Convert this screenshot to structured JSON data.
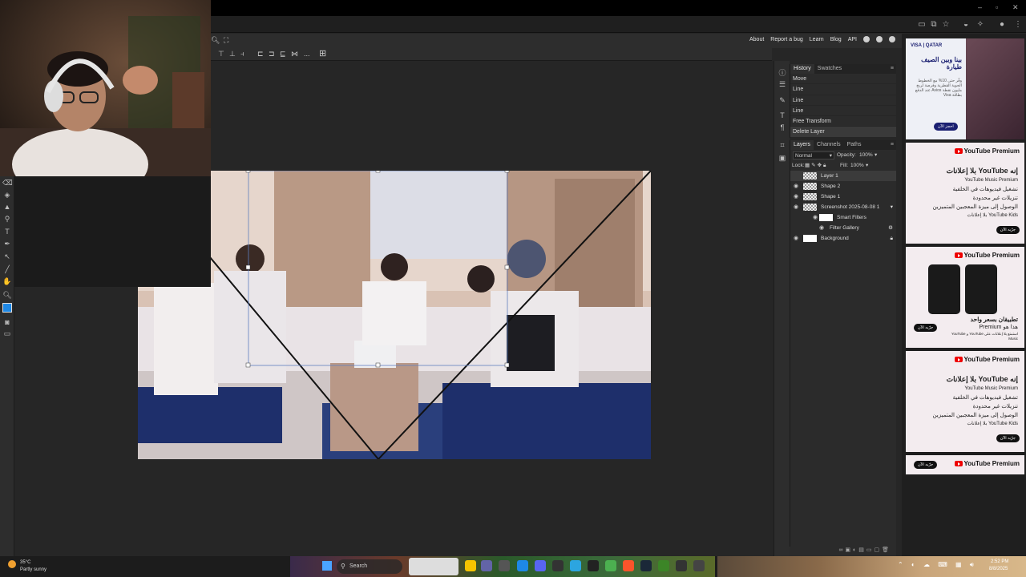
{
  "menu": {
    "links": [
      "About",
      "Report a bug",
      "Learn",
      "Blog",
      "API"
    ]
  },
  "options_bar": {
    "extra_label": "..."
  },
  "history_panel": {
    "tabs": [
      "History",
      "Swatches"
    ],
    "items": [
      "Move",
      "Line",
      "Line",
      "Line",
      "Free Transform",
      "Delete Layer"
    ]
  },
  "layers_panel": {
    "tabs": [
      "Layers",
      "Channels",
      "Paths"
    ],
    "blend_mode": "Normal",
    "opacity_label": "Opacity:",
    "opacity_value": "100%",
    "lock_label": "Lock:",
    "fill_label": "Fill:",
    "fill_value": "100%",
    "layers": [
      {
        "name": "Layer 1"
      },
      {
        "name": "Shape 2"
      },
      {
        "name": "Shape 1"
      },
      {
        "name": "Screenshot 2025-08-08 1"
      },
      {
        "name": "Smart Filters"
      },
      {
        "name": "Filter Gallery"
      },
      {
        "name": "Background"
      }
    ]
  },
  "ads": {
    "qatar": {
      "brand": "VISA | QATAR",
      "headline": "بينا وبين الصيف طيارة",
      "body": "وفّر حتى 10% مع الخطوط الجوية القطرية وفرصة لربح مليون نقطة Avios عند الدفع بطاقة Visa",
      "cta": "احجز الآن"
    },
    "yt1": {
      "brand": "YouTube Premium",
      "lines": [
        "إنه YouTube بلا إعلانات",
        "YouTube Music Premium",
        "تشغيل فيديوهات في الخلفية",
        "تنزيلات غير محدودة",
        "الوصول إلى ميزة المعجبين المتميزين",
        "YouTube Kids بلا إعلانات"
      ],
      "cta": "جرّبه الآن"
    },
    "yt2": {
      "brand": "YouTube Premium",
      "headline": "تطبيقان بسعر واحد",
      "sub": "هذا هو Premium",
      "body": "استمتع بلا إعلانات على YouTube و YouTube Music",
      "cta": "جرّبه الآن"
    },
    "yt3": {
      "brand": "YouTube Premium",
      "lines": [
        "إنه YouTube بلا إعلانات",
        "YouTube Music Premium",
        "تشغيل فيديوهات في الخلفية",
        "تنزيلات غير محدودة",
        "الوصول إلى ميزة المعجبين المتميزين",
        "YouTube Kids بلا إعلانات"
      ],
      "cta": "جرّبه الآن"
    },
    "yt4": {
      "brand": "YouTube Premium",
      "cta": "جرّبه الآن"
    }
  },
  "taskbar": {
    "weather_temp": "35°C",
    "weather_desc": "Partly sunny",
    "search_label": "Search",
    "clock_time": "2:52 PM",
    "clock_date": "8/8/2025"
  },
  "colors": {
    "accent": "#1e88e5",
    "panel_bg": "#2b2b2b",
    "canvas_bg": "#262626"
  }
}
